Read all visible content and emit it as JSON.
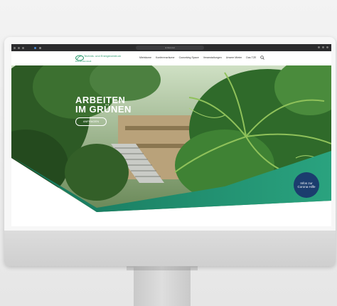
{
  "browser": {
    "url": "● tzes.net"
  },
  "site": {
    "logo_line1": "Technik- und Energiezentrum",
    "logo_line2": "Eisenhüttenstadt",
    "nav": [
      "Mieträume",
      "Konferenzräume",
      "Coworking Space",
      "Veranstaltungen",
      "Unsere Mieter",
      "Das TZE"
    ],
    "search_icon": "search-icon"
  },
  "hero": {
    "title_line1": "ARBEITEN",
    "title_line2": "IM GRÜNEN",
    "button_label": "ANFRAGEN",
    "corona_line1": "Infos zur",
    "corona_line2": "Corona Hilfe"
  },
  "colors": {
    "brand_green": "#2f9c72",
    "corona_blue": "#1b3d6e",
    "hero_wave": "#1f8a6a"
  }
}
